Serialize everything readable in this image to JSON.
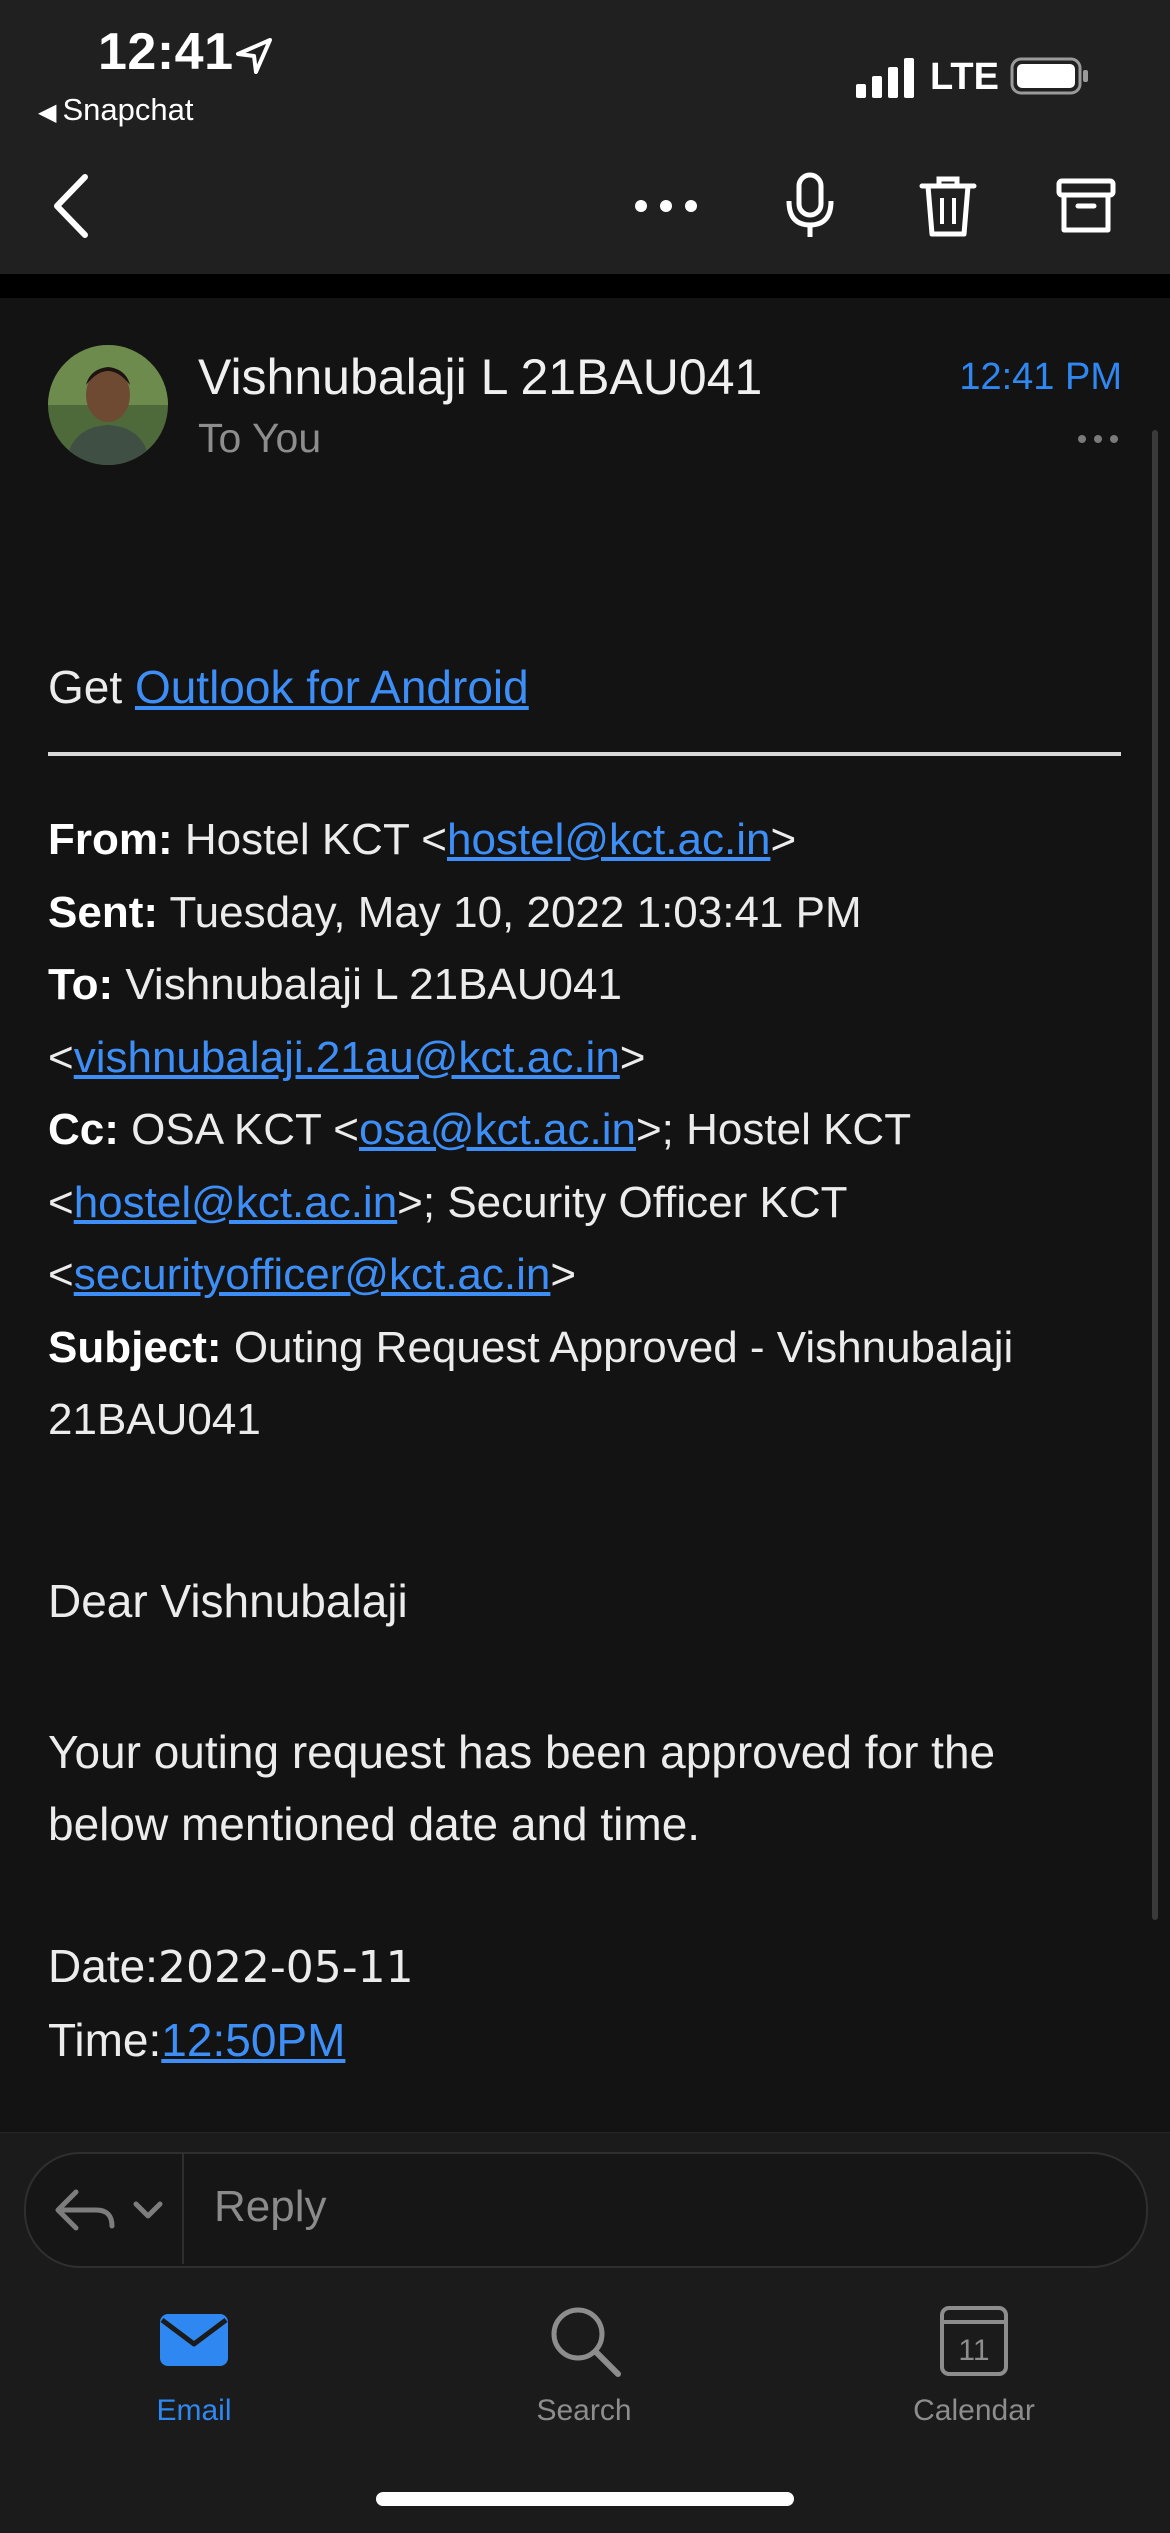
{
  "status_bar": {
    "time": "12:41",
    "back_app": "Snapchat",
    "network": "LTE"
  },
  "toolbar": {
    "back": "chevron-left-icon",
    "actions": [
      "more-icon",
      "microphone-icon",
      "trash-icon",
      "archive-icon"
    ]
  },
  "message": {
    "sender": "Vishnubalaji L 21BAU041",
    "recipient_line": "To You",
    "time": "12:41 PM"
  },
  "body": {
    "get_prefix": "Get",
    "get_link": "Outlook for Android",
    "from_label": "From:",
    "from_name": "Hostel KCT <",
    "from_email": "hostel@kct.ac.in",
    "from_close": ">",
    "sent_label": "Sent:",
    "sent_value": "Tuesday, May 10, 2022 1:03:41 PM",
    "to_label": "To:",
    "to_name": "Vishnubalaji L 21BAU041",
    "to_open": "<",
    "to_email": "vishnubalaji.21au@kct.ac.in",
    "to_close": ">",
    "cc_label": "Cc:",
    "cc_name1": "OSA KCT <",
    "cc_email1": "osa@kct.ac.in",
    "cc_sep1": ">; Hostel KCT",
    "cc_open2": "<",
    "cc_email2": "hostel@kct.ac.in",
    "cc_sep2": ">; Security Officer KCT",
    "cc_open3": "<",
    "cc_email3": "securityofficer@kct.ac.in",
    "cc_close3": ">",
    "subject_label": "Subject:",
    "subject_value_1": "Outing Request Approved - Vishnubalaji",
    "subject_value_2": "21BAU041",
    "greeting": "Dear Vishnubalaji",
    "paragraph_1": "Your outing request has been approved for the",
    "paragraph_2": "below mentioned date and time.",
    "date_label": "Date:",
    "date_value": "2022-05-11",
    "time_label": "Time:",
    "time_value": "12:50PM"
  },
  "reply": {
    "placeholder": "Reply"
  },
  "tabs": [
    {
      "label": "Email",
      "icon": "mail-icon",
      "active": true
    },
    {
      "label": "Search",
      "icon": "search-icon",
      "active": false
    },
    {
      "label": "Calendar",
      "icon": "calendar-icon",
      "active": false,
      "badge": "11"
    }
  ],
  "colors": {
    "accent": "#2f88f2",
    "background": "#131313",
    "header": "#202020"
  }
}
